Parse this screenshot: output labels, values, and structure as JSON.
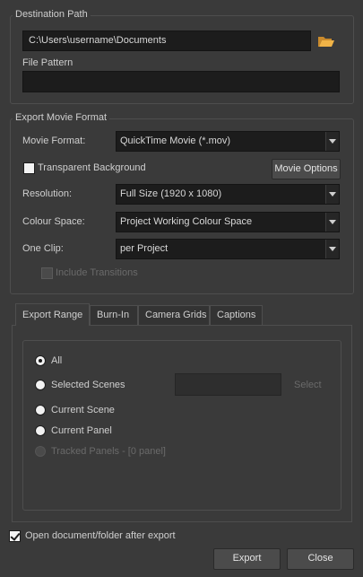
{
  "destination": {
    "group_title": "Destination Path",
    "path_value": "C:\\Users\\username\\Documents",
    "folder_icon": "folder-open-icon",
    "file_pattern_label": "File Pattern",
    "file_pattern_value": ""
  },
  "export_format": {
    "group_title": "Export Movie Format",
    "movie_format_label": "Movie Format:",
    "movie_format_value": "QuickTime Movie (*.mov)",
    "transparent_label": "Transparent Background",
    "transparent_checked": false,
    "movie_options_label": "Movie Options",
    "resolution_label": "Resolution:",
    "resolution_value": "Full Size (1920 x 1080)",
    "colour_space_label": "Colour Space:",
    "colour_space_value": "Project Working Colour Space",
    "one_clip_label": "One Clip:",
    "one_clip_value": "per Project",
    "include_transitions_label": "Include Transitions",
    "include_transitions_enabled": false
  },
  "tabs": [
    {
      "label": "Export Range",
      "active": true
    },
    {
      "label": "Burn-In",
      "active": false
    },
    {
      "label": "Camera Grids",
      "active": false
    },
    {
      "label": "Captions",
      "active": false
    }
  ],
  "export_range": {
    "all_label": "All",
    "selected_scenes_label": "Selected Scenes",
    "select_button_label": "Select",
    "current_scene_label": "Current Scene",
    "current_panel_label": "Current Panel",
    "tracked_panels_label": "Tracked Panels - [0 panel]",
    "selected_option": "All"
  },
  "footer": {
    "open_after_export_label": "Open document/folder after export",
    "open_after_export_checked": true,
    "export_button": "Export",
    "close_button": "Close"
  },
  "colors": {
    "background": "#3a3a3a",
    "field_background": "#1c1c1c",
    "text": "#cfcfcf",
    "disabled_text": "#6a6a6a",
    "folder_icon": "#e8a33a"
  }
}
